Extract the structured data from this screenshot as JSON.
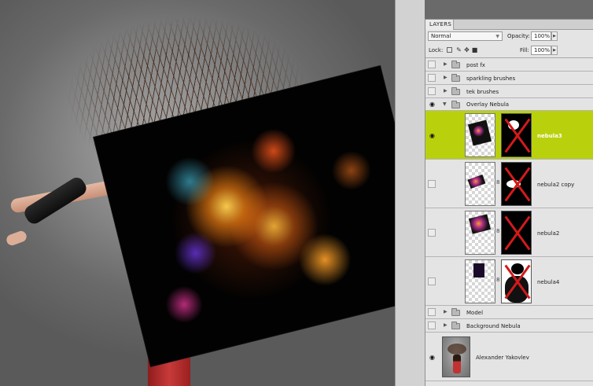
{
  "panel": {
    "tab": "LAYERS",
    "blend_mode": "Normal",
    "opacity_label": "Opacity:",
    "opacity_value": "100%",
    "lock_label": "Lock:",
    "fill_label": "Fill:",
    "fill_value": "100%"
  },
  "layers": [
    {
      "name": "post fx",
      "kind": "group",
      "visible": false,
      "expanded": false
    },
    {
      "name": "sparkling brushes",
      "kind": "group",
      "visible": false,
      "expanded": false
    },
    {
      "name": "tek brushes",
      "kind": "group",
      "visible": false,
      "expanded": false
    },
    {
      "name": "Overlay Nebula",
      "kind": "group",
      "visible": true,
      "expanded": true
    },
    {
      "name": "nebula3",
      "kind": "layer",
      "visible": true,
      "selected": true
    },
    {
      "name": "nebula2 copy",
      "kind": "layer",
      "visible": false
    },
    {
      "name": "nebula2",
      "kind": "layer",
      "visible": false
    },
    {
      "name": "nebula4",
      "kind": "layer",
      "visible": false
    },
    {
      "name": "Model",
      "kind": "group",
      "visible": false,
      "expanded": false
    },
    {
      "name": "Background Nebula",
      "kind": "group",
      "visible": false,
      "expanded": false
    },
    {
      "name": "Alexander Yakovlev",
      "kind": "layer",
      "visible": true
    }
  ],
  "colors": {
    "selected_row": "#b9d10c",
    "mask_cross": "#d21a1a",
    "panel_bg": "#e4e4e4"
  }
}
